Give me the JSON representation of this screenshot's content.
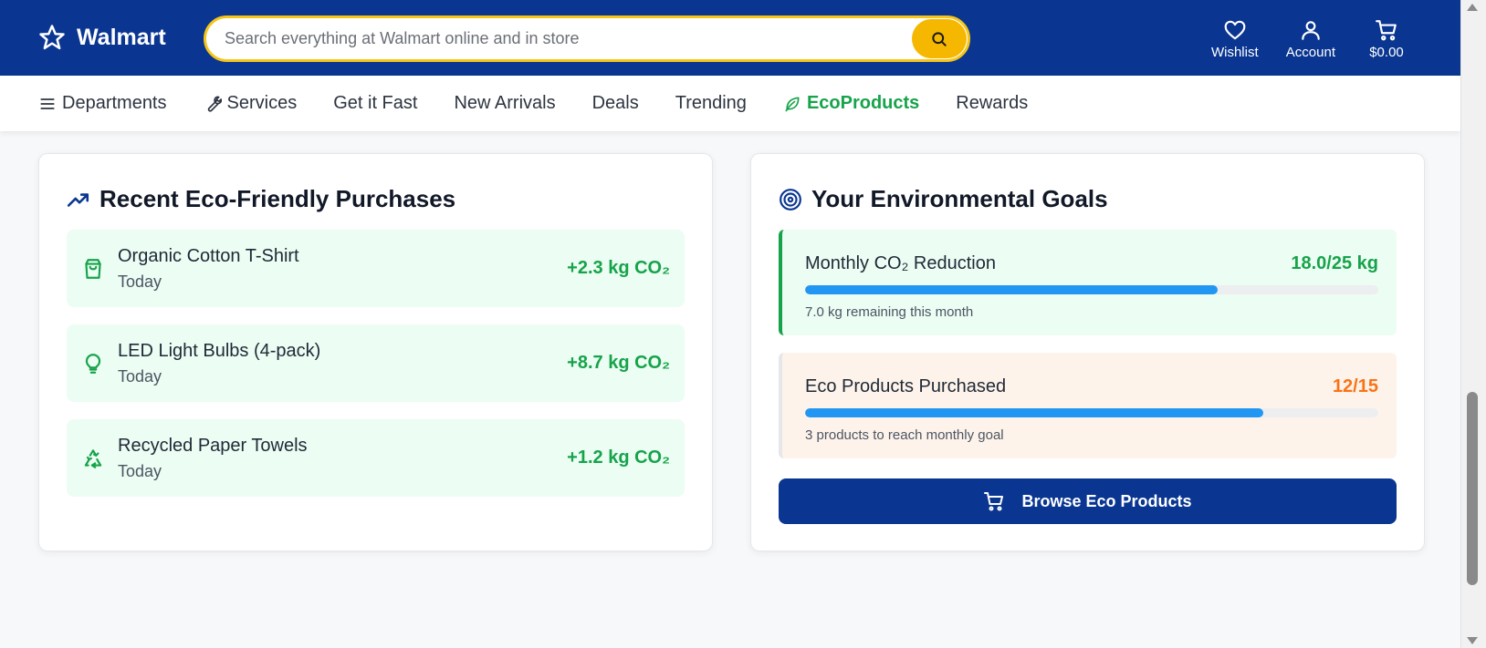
{
  "header": {
    "brand": "Walmart",
    "search_placeholder": "Search everything at Walmart online and in store",
    "actions": [
      {
        "label": "Wishlist",
        "icon": "heart-icon"
      },
      {
        "label": "Account",
        "icon": "user-icon"
      },
      {
        "label": "$0.00",
        "icon": "cart-icon"
      }
    ]
  },
  "nav": {
    "items": [
      {
        "label": "Departments",
        "icon": "menu-icon"
      },
      {
        "label": "Services",
        "icon": "wrench-icon"
      },
      {
        "label": "Get it Fast"
      },
      {
        "label": "New Arrivals"
      },
      {
        "label": "Deals"
      },
      {
        "label": "Trending"
      },
      {
        "label": "EcoProducts",
        "icon": "leaf-icon",
        "active": true
      },
      {
        "label": "Rewards"
      }
    ]
  },
  "purchases": {
    "title": "Recent Eco-Friendly Purchases",
    "items": [
      {
        "name": "Organic Cotton T-Shirt",
        "date": "Today",
        "co2": "+2.3 kg CO₂",
        "icon": "shopping-bag-icon"
      },
      {
        "name": "LED Light Bulbs (4-pack)",
        "date": "Today",
        "co2": "+8.7 kg CO₂",
        "icon": "lightbulb-icon"
      },
      {
        "name": "Recycled Paper Towels",
        "date": "Today",
        "co2": "+1.2 kg CO₂",
        "icon": "recycle-icon"
      }
    ]
  },
  "goals": {
    "title": "Your Environmental Goals",
    "co2": {
      "name": "Monthly CO₂ Reduction",
      "value": "18.0/25 kg",
      "progress": 0.72,
      "note": "7.0 kg remaining this month"
    },
    "eco": {
      "name": "Eco Products Purchased",
      "value": "12/15",
      "progress": 0.8,
      "note": "3 products to reach monthly goal"
    },
    "button_label": "Browse Eco Products"
  },
  "colors": {
    "header_bg": "#0a3691",
    "accent_yellow": "#f5b700",
    "eco_green": "#16a34a",
    "progress_blue": "#2196f3",
    "orange": "#f97316"
  }
}
